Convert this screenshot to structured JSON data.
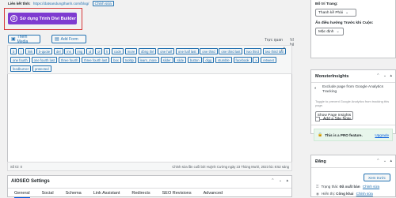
{
  "permalink": {
    "label": "Liên kết tĩnh:",
    "url": "https://datsandungthanh.com/blog/",
    "edit_label": "Chỉnh sửa"
  },
  "divi_button": {
    "label": "Sử dụng Trình Divi Builder",
    "icon": "D"
  },
  "media": {
    "add_media_label": "Thêm Media",
    "add_form_label": "Add Form"
  },
  "editor_tabs": {
    "visual": "Trực quan",
    "text": "Văn bản"
  },
  "quicktags": [
    "b",
    "i",
    "link",
    "b-quote",
    "del",
    "ins",
    "img",
    "ul",
    "ol",
    "li",
    "code",
    "more",
    "đóng thẻ",
    "one half",
    "one half last",
    "one third",
    "one third last",
    "two third",
    "two third last",
    "one fourth",
    "one fourth last",
    "three fourth",
    "three fourth last",
    "box",
    "tooltip",
    "learn_more",
    "slider",
    "slide",
    "button",
    "digg",
    "stumble",
    "facebook",
    "x",
    "retweet",
    "feedburner",
    "protected"
  ],
  "statusbar": {
    "word_count": "Số từ: 0",
    "last_edited": "Chỉnh sửa lần cuối bởi Huỳnh Cường ngày 23 Tháng Mười, 2023 lúc 8:52 sáng"
  },
  "aioseo": {
    "title": "AIOSEO Settings",
    "tabs": [
      "General",
      "Social",
      "Schema",
      "Link Assistant",
      "Redirects",
      "SEO Revisions",
      "Advanced"
    ],
    "active_tab": "General"
  },
  "page_attributes": {
    "template_label": "Bố trí Trang:",
    "template_value": "Thanh kề Phải",
    "nav_label": "Ẩn điều hướng Trước khi Cuộn:",
    "nav_value": "Mặc định"
  },
  "monsterinsights": {
    "title": "MonsterInsights",
    "exclude_text": "Exclude page from Google Analytics Tracking",
    "toggle_text": "Toggle to prevent Google Analytics from tracking this page.",
    "show_insights": "Show Page Insights",
    "site_note": "Add a Site Note",
    "pro_text": "This is a PRO feature.",
    "upgrade": "Upgrade"
  },
  "publish": {
    "title": "Đăng",
    "preview_label": "Xem trước",
    "status_label": "Trạng thái:",
    "status_value": "Đã xuất bản",
    "status_edit": "Chỉnh sửa",
    "visibility_label": "Hiển thị:",
    "visibility_value": "Công khai",
    "visibility_edit": "Chỉnh sửa"
  }
}
